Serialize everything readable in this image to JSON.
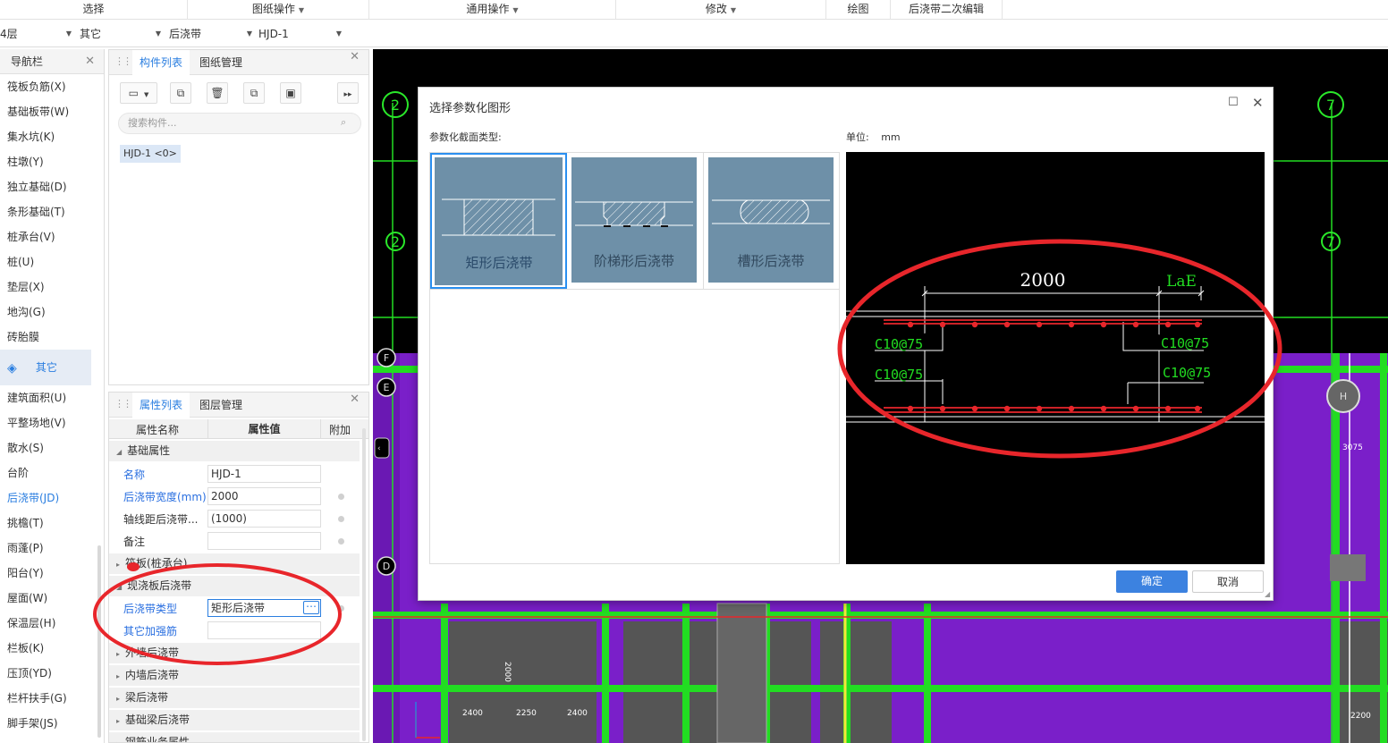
{
  "ribbon": {
    "groups": [
      "选择",
      "图纸操作",
      "通用操作",
      "修改",
      "绘图",
      "后浇带二次编辑"
    ]
  },
  "combos": [
    "4层",
    "其它",
    "后浇带",
    "HJD-1"
  ],
  "nav": {
    "title": "导航栏",
    "items_top": [
      "筏板负筋(X)",
      "基础板带(W)",
      "集水坑(K)",
      "柱墩(Y)",
      "独立基础(D)",
      "条形基础(T)",
      "桩承台(V)",
      "桩(U)",
      "垫层(X)",
      "地沟(G)",
      "砖胎膜"
    ],
    "selected": "其它",
    "items_bottom": [
      "建筑面积(U)",
      "平整场地(V)",
      "散水(S)",
      "台阶",
      "后浇带(JD)",
      "挑檐(T)",
      "雨蓬(P)",
      "阳台(Y)",
      "屋面(W)",
      "保温层(H)",
      "栏板(K)",
      "压顶(YD)",
      "栏杆扶手(G)",
      "脚手架(JS)"
    ]
  },
  "components": {
    "tabs": [
      "构件列表",
      "图纸管理"
    ],
    "search_placeholder": "搜索构件...",
    "items": [
      "HJD-1 <0>"
    ]
  },
  "properties": {
    "tabs": [
      "属性列表",
      "图层管理"
    ],
    "headers": [
      "属性名称",
      "属性值",
      "附加"
    ],
    "group_basic": "基础属性",
    "rows": [
      {
        "name": "名称",
        "value": "HJD-1"
      },
      {
        "name": "后浇带宽度(mm)",
        "value": "2000"
      },
      {
        "name": "轴线距后浇带...",
        "value": "(1000)"
      },
      {
        "name": "备注",
        "value": ""
      }
    ],
    "group_raft": "筏板(桩承台)...",
    "group_slab": "现浇板后浇带",
    "slab_rows": [
      {
        "name": "后浇带类型",
        "value": "矩形后浇带"
      },
      {
        "name": "其它加强筋",
        "value": ""
      }
    ],
    "more_groups": [
      "外墙后浇带",
      "内墙后浇带",
      "梁后浇带",
      "基础梁后浇带",
      "钢筋业务属性"
    ]
  },
  "dialog": {
    "title": "选择参数化图形",
    "section_label": "参数化截面类型:",
    "unit_label": "单位:",
    "unit_value": "mm",
    "types": [
      "矩形后浇带",
      "阶梯形后浇带",
      "槽形后浇带"
    ],
    "preview": {
      "width": "2000",
      "lae": "LaE",
      "rebar": "C10@75"
    },
    "ok": "确定",
    "cancel": "取消"
  },
  "cad": {
    "axes": [
      "2",
      "7",
      "E",
      "D",
      "F",
      "H"
    ],
    "dims": [
      "2000",
      "2400",
      "2250",
      "2400",
      "3075",
      "2200"
    ]
  },
  "colors": {
    "accent": "#2a7ee0",
    "button": "#3c82e0",
    "cad_bg": "#000000",
    "wall": "#7a1fc9",
    "green": "#22dd22",
    "red_mark": "#e8262b"
  }
}
